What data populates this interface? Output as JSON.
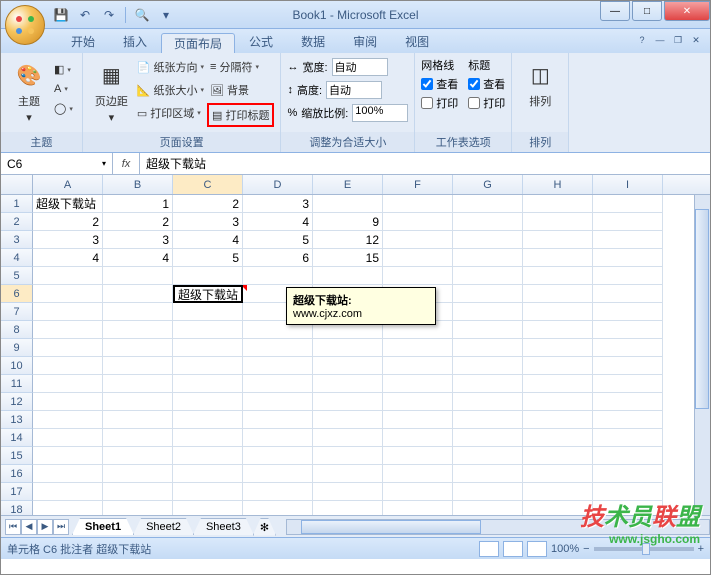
{
  "title": "Book1 - Microsoft Excel",
  "tabs": {
    "home": "开始",
    "insert": "插入",
    "pagelayout": "页面布局",
    "formulas": "公式",
    "data": "数据",
    "review": "审阅",
    "view": "视图"
  },
  "ribbon": {
    "themes": {
      "label": "主题",
      "btn": "主题"
    },
    "pagesetup": {
      "label": "页面设置",
      "margins": "页边距",
      "orientation": "纸张方向",
      "size": "纸张大小",
      "printarea": "打印区域",
      "breaks": "分隔符",
      "background": "背景",
      "titles": "打印标题"
    },
    "scale": {
      "label": "调整为合适大小",
      "width": "宽度:",
      "height": "高度:",
      "scale": "缩放比例:",
      "auto": "自动",
      "scale_val": "100%"
    },
    "sheetopts": {
      "label": "工作表选项",
      "gridlines": "网格线",
      "headings": "标题",
      "view": "查看",
      "print": "打印"
    },
    "arrange": {
      "label": "排列",
      "btn": "排列"
    }
  },
  "namebox": "C6",
  "formula": "超级下载站",
  "columns": [
    "A",
    "B",
    "C",
    "D",
    "E",
    "F",
    "G",
    "H",
    "I"
  ],
  "rows": [
    "1",
    "2",
    "3",
    "4",
    "5",
    "6",
    "7",
    "8",
    "9",
    "10",
    "11",
    "12",
    "13",
    "14",
    "15",
    "16",
    "17",
    "18"
  ],
  "cells": {
    "A1": "超级下载站",
    "B1": "1",
    "C1": "2",
    "D1": "3",
    "A2": "2",
    "B2": "2",
    "C2": "3",
    "D2": "4",
    "E2": "9",
    "A3": "3",
    "B3": "3",
    "C3": "4",
    "D3": "5",
    "E3": "12",
    "A4": "4",
    "B4": "4",
    "C4": "5",
    "D4": "6",
    "E4": "15",
    "C6": "超级下载站"
  },
  "comment": {
    "title": "超级下载站:",
    "body": "www.cjxz.com"
  },
  "sheets": {
    "s1": "Sheet1",
    "s2": "Sheet2",
    "s3": "Sheet3"
  },
  "status": "单元格 C6 批注者 超级下载站",
  "zoom": "100%",
  "watermark": {
    "text1": "技术员联盟",
    "text2": "www.jsgho.com"
  }
}
